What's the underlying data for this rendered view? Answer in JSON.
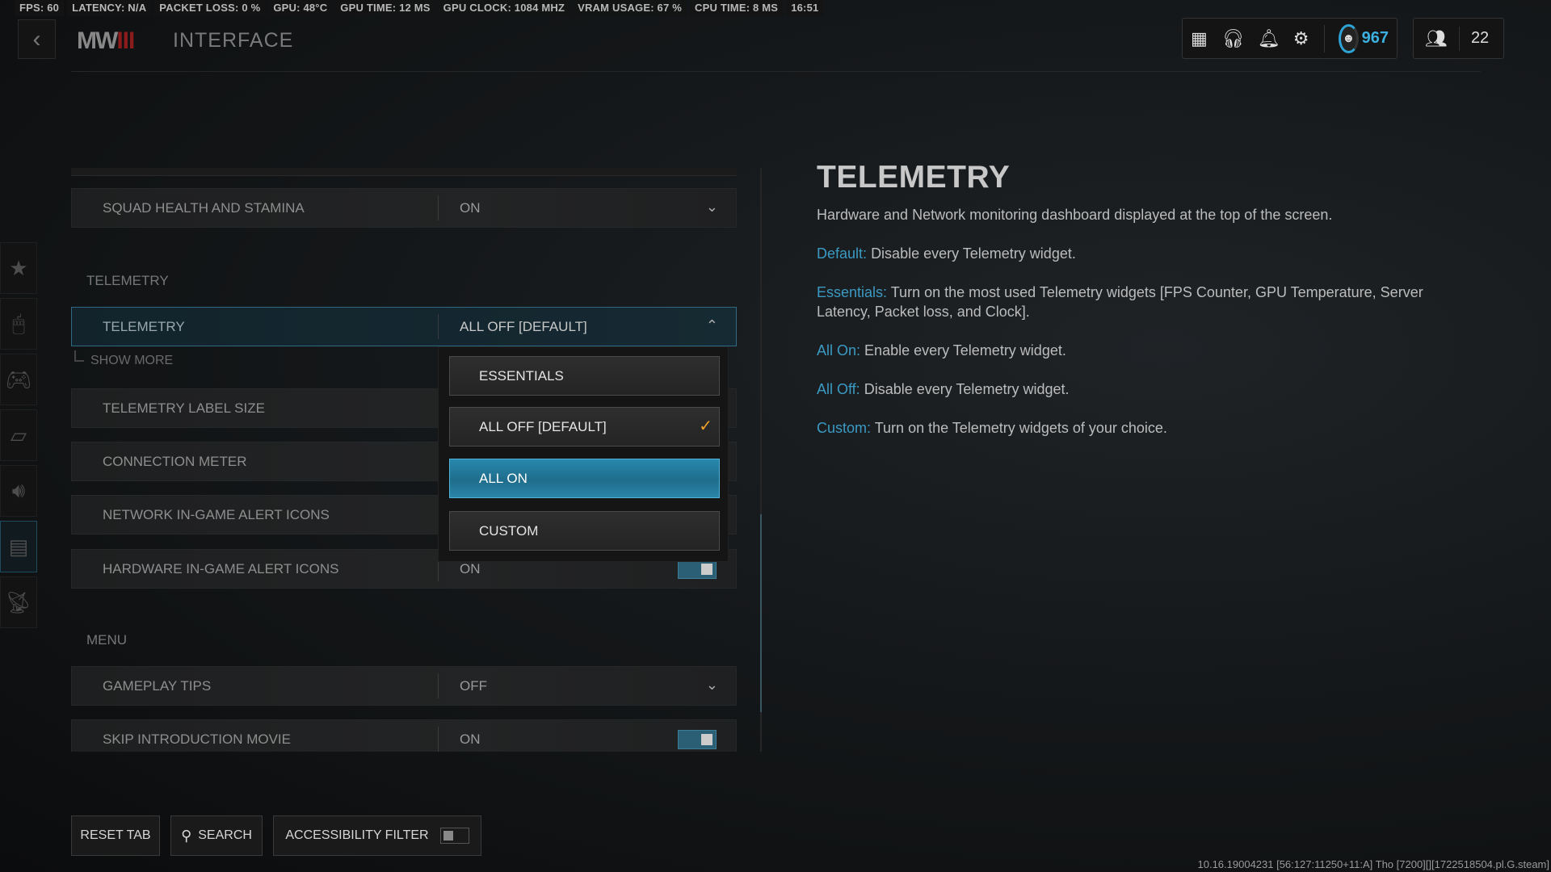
{
  "telemetry_bar": [
    "FPS: 60",
    "LATENCY: N/A",
    "PACKET LOSS: 0 %",
    "GPU: 48°C",
    "GPU TIME: 12 MS",
    "GPU CLOCK: 1084 MHZ",
    "VRAM USAGE: 67 %",
    "CPU TIME: 8 MS",
    "16:51"
  ],
  "header": {
    "back_icon": "chevron-left",
    "logo": "MWIII",
    "title": "INTERFACE",
    "icons": [
      "grid-icon",
      "headset-icon",
      "bell-icon",
      "gear-icon"
    ],
    "level": "967",
    "party_count": "22",
    "accent": "#2ea3d6"
  },
  "sidebar": [
    "star-icon",
    "mouse-icon",
    "controller-icon",
    "display-icon",
    "speaker-icon",
    "interface-icon",
    "network-icon"
  ],
  "sections": {
    "telemetry": "TELEMETRY",
    "menu": "MENU"
  },
  "rows": [
    {
      "label": "SQUAD HEALTH AND STAMINA",
      "value": "ON",
      "control": "dropdown"
    },
    {
      "label": "TELEMETRY",
      "value": "ALL OFF [DEFAULT]",
      "control": "dropdown-open"
    },
    {
      "label": "TELEMETRY LABEL SIZE",
      "value": "",
      "control": "hidden"
    },
    {
      "label": "CONNECTION METER",
      "value": "",
      "control": "hidden"
    },
    {
      "label": "NETWORK IN-GAME ALERT ICONS",
      "value": "",
      "control": "hidden"
    },
    {
      "label": "HARDWARE IN-GAME ALERT ICONS",
      "value": "ON",
      "control": "toggle"
    },
    {
      "label": "GAMEPLAY TIPS",
      "value": "OFF",
      "control": "dropdown"
    },
    {
      "label": "SKIP INTRODUCTION MOVIE",
      "value": "ON",
      "control": "toggle"
    }
  ],
  "show_more": "SHOW MORE",
  "dropdown": {
    "options": [
      "ESSENTIALS",
      "ALL OFF [DEFAULT]",
      "ALL ON",
      "CUSTOM"
    ],
    "selected": "ALL OFF [DEFAULT]",
    "highlighted": "ALL ON",
    "check_color": "#f0a12c"
  },
  "info": {
    "title": "TELEMETRY",
    "description": "Hardware and Network monitoring dashboard displayed at the top of the screen.",
    "items": [
      {
        "key": "Default:",
        "text": "Disable every Telemetry widget."
      },
      {
        "key": "Essentials:",
        "text": "Turn on the most used Telemetry widgets [FPS Counter, GPU Temperature, Server Latency, Packet loss, and Clock]."
      },
      {
        "key": "All On:",
        "text": "Enable every Telemetry widget."
      },
      {
        "key": "All Off:",
        "text": "Disable every Telemetry widget."
      },
      {
        "key": "Custom:",
        "text": "Turn on the Telemetry widgets of your choice."
      }
    ],
    "key_color": "#3b9ac4"
  },
  "footer": {
    "reset": "RESET TAB",
    "search": "SEARCH",
    "accessibility": "ACCESSIBILITY FILTER",
    "accessibility_on": false
  },
  "version": "10.16.19004231 [56:127:11250+11:A] Tho [7200][][1722518504.pl.G.steam]"
}
